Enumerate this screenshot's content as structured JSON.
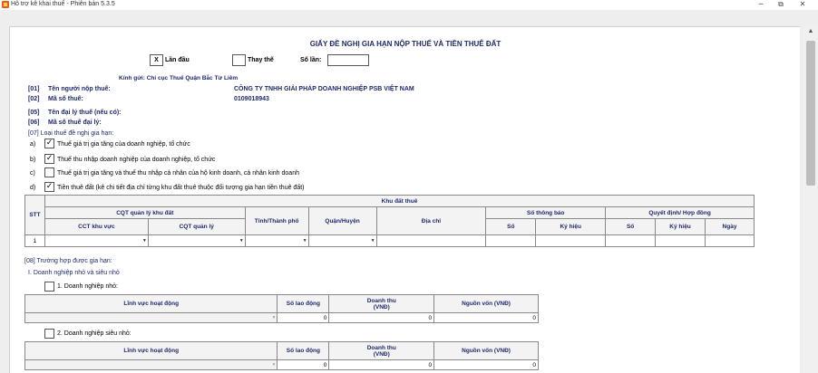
{
  "window": {
    "title": "Hỗ trợ kê khai thuế - Phiên bản 5.3.5",
    "minimize": "─",
    "restore": "⧉",
    "close": "✕"
  },
  "form": {
    "title": "GIẤY ĐỀ NGHỊ GIA HẠN NỘP THUẾ VÀ TIỀN THUÊ ĐẤT",
    "first_time_mark": "X",
    "first_time_label": "Lần đầu",
    "replace_label": "Thay thế",
    "times_label": "Số lần:",
    "times_value": "",
    "sent_to": "Kính gửi:  Chi cục Thuế Quận Bắc Từ Liêm",
    "f01_code": "[01]",
    "f01_label": "Tên người nộp thuế:",
    "f01_value": "CÔNG TY TNHH GIẢI PHÁP DOANH NGHIỆP PSB VIỆT NAM",
    "f02_code": "[02]",
    "f02_label": "Mã số thuế:",
    "f02_value": "0109018943",
    "f05_code": "[05]",
    "f05_label": "Tên đại lý thuế (nếu có):",
    "f06_code": "[06]",
    "f06_label": "Mã số thuế đại lý:",
    "f07_label": "[07]   Loại thuế đề nghị gia hạn:",
    "tax_types": [
      {
        "letter": "a)",
        "checked": true,
        "label": "Thuế giá trị gia tăng của doanh nghiệp, tổ chức"
      },
      {
        "letter": "b)",
        "checked": true,
        "label": "Thuế thu nhập doanh nghiệp của doanh nghiệp, tổ chức"
      },
      {
        "letter": "c)",
        "checked": false,
        "label": "Thuế giá trị gia tăng và thuế thu nhập cá nhân của hộ kinh doanh, cá nhân kinh doanh"
      },
      {
        "letter": "d)",
        "checked": true,
        "label": "Tiền thuê đất (kê chi tiết địa chỉ từng khu đất thuê thuộc đối tượng gia hạn tiền thuê đất)"
      }
    ],
    "check_mark": "✓"
  },
  "land_table": {
    "stt": "STT",
    "group": "Khu đất thuê",
    "cqt_group": "CQT quản lý khu đất",
    "cct": "CCT khu vực",
    "cqt": "CQT quản lý",
    "province": "Tỉnh/Thành phố",
    "district": "Quận/Huyện",
    "address": "Địa chỉ",
    "notice_group": "Số thông báo",
    "decision_group": "Quyết định/ Hợp đồng",
    "so": "Số",
    "kyhieu": "Ký hiệu",
    "ngay": "Ngày",
    "row_no": "1",
    "arrow": "▼"
  },
  "section08": {
    "label": "[08]   Trường hợp được gia hạn:",
    "group1": "I. Doanh nghiệp nhỏ và siêu nhỏ",
    "small_label": "1. Doanh nghiệp nhỏ:",
    "micro_label": "2. Doanh nghiệp siêu nhỏ:",
    "col_field": "Lĩnh vực hoạt động",
    "col_workers": "Số lao động",
    "col_revenue_1": "Doanh thu",
    "col_revenue_2": "(VNĐ)",
    "col_capital": "Nguồn vốn (VNĐ)",
    "small_values": [
      "0",
      "0",
      "0"
    ],
    "micro_values": [
      "0",
      "0",
      "0"
    ]
  },
  "scrollbar": {
    "up": "▲"
  }
}
